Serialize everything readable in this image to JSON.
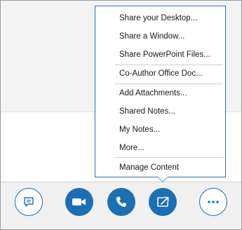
{
  "menu": {
    "items": [
      {
        "label": "Share your Desktop..."
      },
      {
        "label": "Share a Window..."
      },
      {
        "label": "Share PowerPoint Files..."
      },
      {
        "label": "Co-Author Office Doc..."
      },
      {
        "label": "Add Attachments..."
      },
      {
        "label": "Shared Notes..."
      },
      {
        "label": "My Notes..."
      },
      {
        "label": "More..."
      },
      {
        "label": "Manage Content"
      }
    ]
  },
  "toolbar": {
    "buttons": [
      {
        "icon": "chat-icon"
      },
      {
        "icon": "video-icon"
      },
      {
        "icon": "phone-icon"
      },
      {
        "icon": "present-icon"
      },
      {
        "icon": "more-options-icon"
      }
    ]
  },
  "colors": {
    "accent": "#1b6fb5",
    "menu_border": "#2a74b8"
  }
}
